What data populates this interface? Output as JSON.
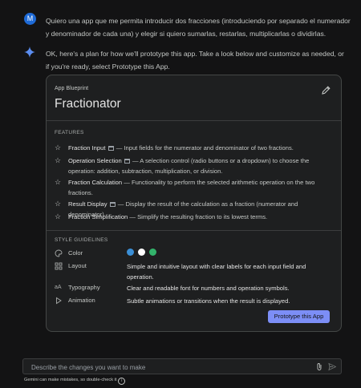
{
  "user": {
    "avatar_letter": "M",
    "message": "Quiero una app que me permita introducir dos fracciones (introduciendo por separado el numerador y denominador de cada una) y elegir si quiero sumarlas, restarlas, multiplicarlas o dividirlas."
  },
  "assistant": {
    "message": "OK, here's a plan for how we'll prototype this app. Take a look below and customize as needed, or if you're ready, select Prototype this App."
  },
  "blueprint": {
    "kicker": "App Blueprint",
    "title": "Fractionator",
    "features_label": "FEATURES",
    "features": [
      {
        "name": "Fraction Input",
        "desc": "— Input fields for the numerator and denominator of two fractions.",
        "ui_icon": true
      },
      {
        "name": "Operation Selection",
        "desc": "— A selection control (radio buttons or a dropdown) to choose the operation: addition, subtraction, multiplication, or division.",
        "ui_icon": true
      },
      {
        "name": "Fraction Calculation",
        "desc": "— Functionality to perform the selected arithmetic operation on the two fractions.",
        "ui_icon": false
      },
      {
        "name": "Result Display",
        "desc": "— Display the result of the calculation as a fraction (numerator and denominator).",
        "ui_icon": true
      },
      {
        "name": "Fraction Simplification",
        "desc": "— Simplify the resulting fraction to its lowest terms.",
        "ui_icon": false
      }
    ],
    "style_label": "STYLE GUIDELINES",
    "guidelines": {
      "color": {
        "name": "Color",
        "swatches": [
          "#3b8fd6",
          "#ffffff",
          "#33b36b"
        ]
      },
      "layout": {
        "name": "Layout",
        "value": "Simple and intuitive layout with clear labels for each input field and operation."
      },
      "typography": {
        "name": "Typography",
        "value": "Clear and readable font for numbers and operation symbols."
      },
      "animation": {
        "name": "Animation",
        "value": "Subtle animations or transitions when the result is displayed."
      }
    },
    "button_label": "Prototype this App"
  },
  "composer": {
    "placeholder": "Describe the changes you want to make",
    "disclaimer": "Gemini can make mistakes, so double-check it"
  }
}
